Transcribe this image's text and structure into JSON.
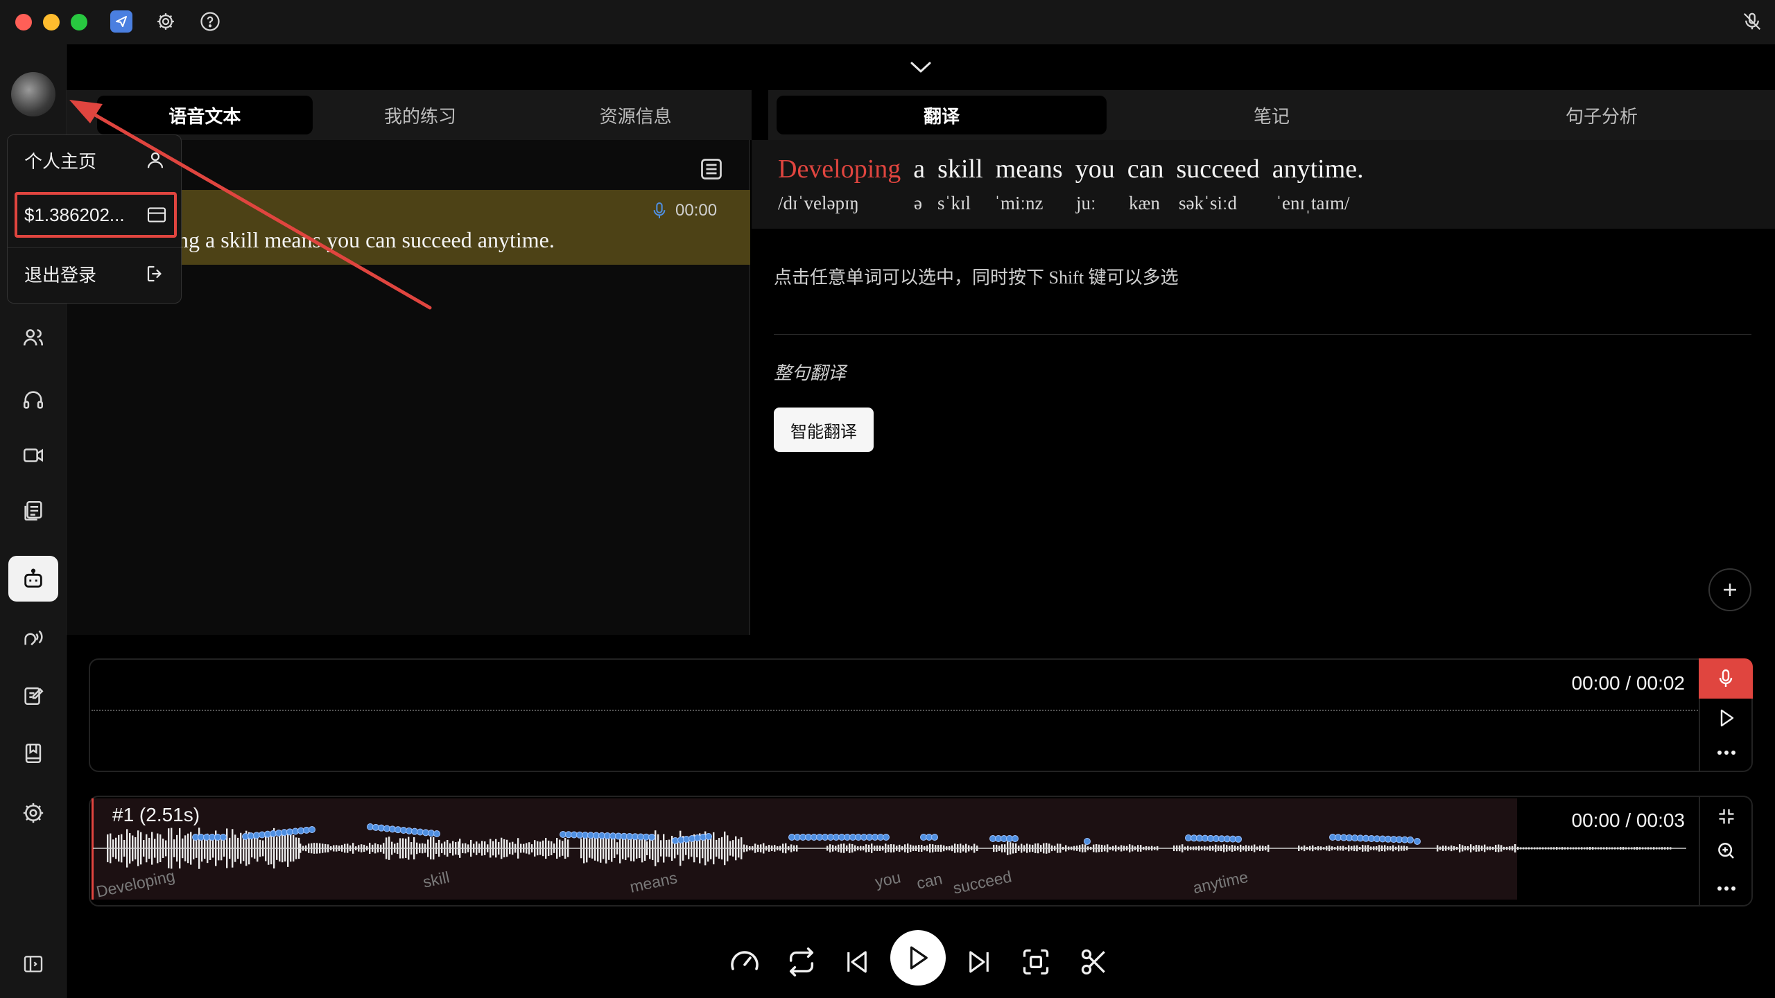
{
  "titlebar": {
    "traffic_lights": [
      "#ff5f57",
      "#febc2e",
      "#28c840"
    ],
    "icons": [
      "app-icon",
      "gear-icon",
      "help-icon",
      "mic-off-icon"
    ]
  },
  "sidebar": {
    "avatar": "avatar",
    "items": [
      "users-icon",
      "headphones-icon",
      "video-icon",
      "document-icon",
      "robot-icon",
      "speaker-icon",
      "edit-icon",
      "bookmark-icon",
      "gear-icon"
    ],
    "active_item": "robot-icon",
    "bottom_icon": "sidebar-toggle-icon"
  },
  "dropdown": {
    "profile_label": "个人主页",
    "balance_label": "$1.386202...",
    "logout_label": "退出登录"
  },
  "left_tabs": [
    "语音文本",
    "我的练习",
    "资源信息"
  ],
  "left_active_tab": 0,
  "right_tabs": [
    "翻译",
    "笔记",
    "句子分析"
  ],
  "right_active_tab": 0,
  "transcript": {
    "timestamp": "00:00",
    "text": "ng a skill means you can succeed anytime."
  },
  "translation": {
    "words": [
      "Developing",
      "a",
      "skill",
      "means",
      "you",
      "can",
      "succeed",
      "anytime."
    ],
    "highlight_word": "Developing",
    "phonetics": [
      "/dɪˈveləpɪŋ",
      "ə",
      "sˈkɪl",
      "ˈmiːnz",
      "juː",
      "kæn",
      "səkˈsiːd",
      "ˈenɪˌtaɪm/"
    ],
    "hint": "点击任意单词可以选中，同时按下 Shift 键可以多选",
    "section_title": "整句翻译",
    "smart_translate_button": "智能翻译"
  },
  "recorder": {
    "time": "00:00 / 00:02"
  },
  "waveform": {
    "label": "#1 (2.51s)",
    "time": "00:00 / 00:03",
    "word_labels": [
      "Developing",
      "skill",
      "means",
      "you",
      "can",
      "succeed",
      "anytime"
    ]
  },
  "colors": {
    "accent_red": "#e0453f",
    "highlight_bg": "#4d4216",
    "pitch_dots": "#4f8fe0"
  },
  "player_controls": [
    "speed-icon",
    "repeat-icon",
    "previous-icon",
    "play-icon",
    "next-icon",
    "focus-icon",
    "scissors-icon"
  ]
}
